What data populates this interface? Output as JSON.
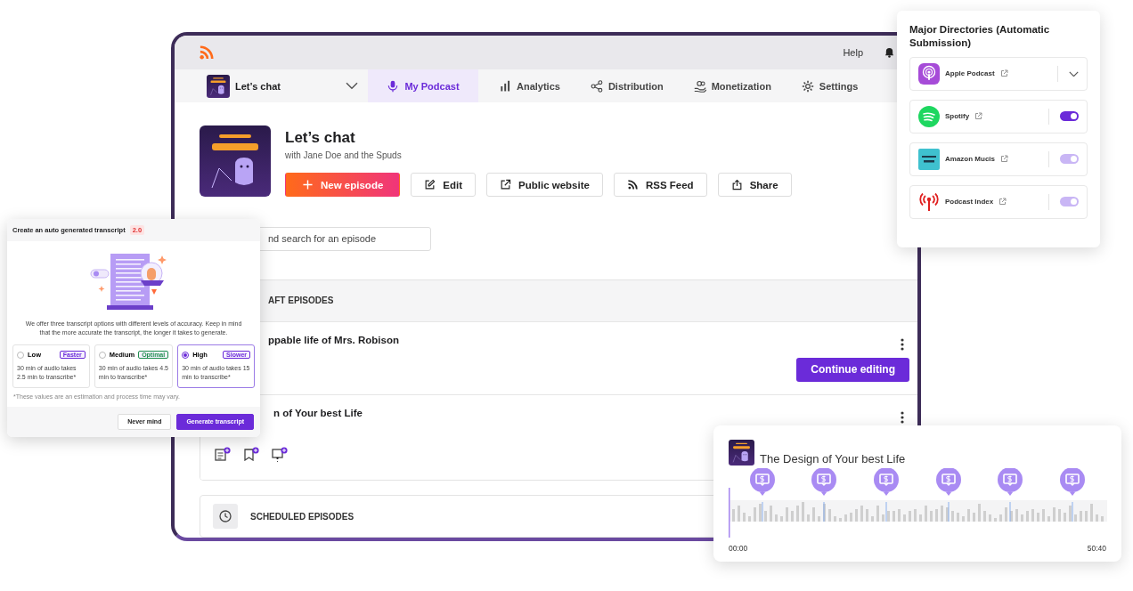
{
  "top_bar": {
    "help": "Help"
  },
  "podcast_selector": {
    "title": "Let’s chat"
  },
  "tabs": [
    {
      "label": "My Podcast",
      "selected": true
    },
    {
      "label": "Analytics",
      "selected": false
    },
    {
      "label": "Distribution",
      "selected": false
    },
    {
      "label": "Monetization",
      "selected": false
    },
    {
      "label": "Settings",
      "selected": false
    }
  ],
  "podcast": {
    "title": "Let’s chat",
    "subtitle": "with Jane Doe and the Spuds"
  },
  "actions": [
    {
      "label": "New episode",
      "kind": "primary"
    },
    {
      "label": "Edit",
      "kind": "secondary"
    },
    {
      "label": "Public website",
      "kind": "secondary"
    },
    {
      "label": "RSS Feed",
      "kind": "secondary"
    },
    {
      "label": "Share",
      "kind": "secondary"
    }
  ],
  "search": {
    "placeholder": "nd search for an episode"
  },
  "drafts": {
    "heading": "AFT EPISODES",
    "episodes": [
      {
        "title": "ppable life of Mrs. Robison",
        "action": "Continue editing"
      },
      {
        "title": "n of Your best Life"
      }
    ]
  },
  "scheduled": {
    "heading": "SCHEDULED EPISODES"
  },
  "transcript_dialog": {
    "title": "Create an auto generated transcript",
    "badge": "2.0",
    "description": "We offer three transcript options with different levels of accuracy. Keep in mind that the more accurate the transcript, the longer it takes to generate.",
    "options": [
      {
        "label": "Low",
        "tag": "Faster",
        "color": "#6b2bd9",
        "note": "30 min of audio takes 2.5 min to transcribe*",
        "selected": false
      },
      {
        "label": "Medium",
        "tag": "Optimal",
        "color": "#1f8f4e",
        "note": "30 min of audio takes 4.5 min to transcribe*",
        "selected": false
      },
      {
        "label": "High",
        "tag": "Slower",
        "color": "#6b2bd9",
        "note": "30 min of audio takes 15 min to transcribe*",
        "selected": true
      }
    ],
    "footnote": "*These values are an estimation and process time may vary.",
    "buttons": [
      {
        "label": "Never mind",
        "kind": "secondary"
      },
      {
        "label": "Generate transcript",
        "kind": "primary"
      }
    ]
  },
  "directories": {
    "title": "Major Directories (Automatic Submission)",
    "items": [
      {
        "name": "Apple Podcast",
        "kind": "expand"
      },
      {
        "name": "Spotify",
        "kind": "toggle",
        "on": true,
        "disabled": false
      },
      {
        "name": "Amazon Mucis",
        "kind": "toggle",
        "on": true,
        "disabled": true
      },
      {
        "name": "Podcast Index",
        "kind": "toggle",
        "on": true,
        "disabled": true
      }
    ]
  },
  "player": {
    "title": "The Design of Your best Life",
    "start": "00:00",
    "end": "50:40"
  }
}
